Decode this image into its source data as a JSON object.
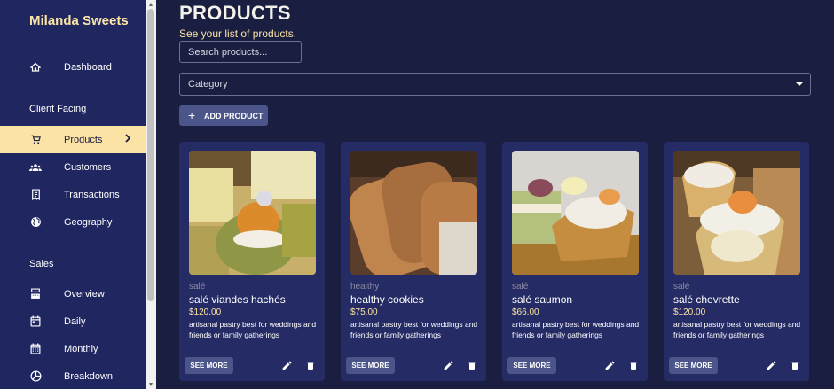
{
  "brand": "Milanda Sweets",
  "sidebar": {
    "dashboard": "Dashboard",
    "client_section": "Client Facing",
    "products": "Products",
    "customers": "Customers",
    "transactions": "Transactions",
    "geography": "Geography",
    "sales_section": "Sales",
    "overview": "Overview",
    "daily": "Daily",
    "monthly": "Monthly",
    "breakdown": "Breakdown"
  },
  "page": {
    "title": "PRODUCTS",
    "subtitle": "See your list of products.",
    "search_placeholder": "Search products...",
    "category_label": "Category",
    "add_button": "ADD PRODUCT"
  },
  "products": [
    {
      "category": "salé",
      "name": "salé viandes hachés",
      "price": "$120.00",
      "description": "artisanal pastry best for weddings and friends or family gatherings",
      "button": "SEE MORE"
    },
    {
      "category": "healthy",
      "name": "healthy cookies",
      "price": "$75.00",
      "description": "artisanal pastry best for weddings and friends or family gatherings",
      "button": "SEE MORE"
    },
    {
      "category": "salé",
      "name": "salé saumon",
      "price": "$66.00",
      "description": "artisanal pastry best for weddings and friends or family gatherings",
      "button": "SEE MORE"
    },
    {
      "category": "salé",
      "name": "salé chevrette",
      "price": "$120.00",
      "description": "artisanal pastry best for weddings and friends or family gatherings",
      "button": "SEE MORE"
    }
  ],
  "colors": {
    "background": "#1a1f42",
    "sidebar": "#202760",
    "accent": "#fbe2a5",
    "card": "#252c65",
    "button": "#4b5589"
  }
}
